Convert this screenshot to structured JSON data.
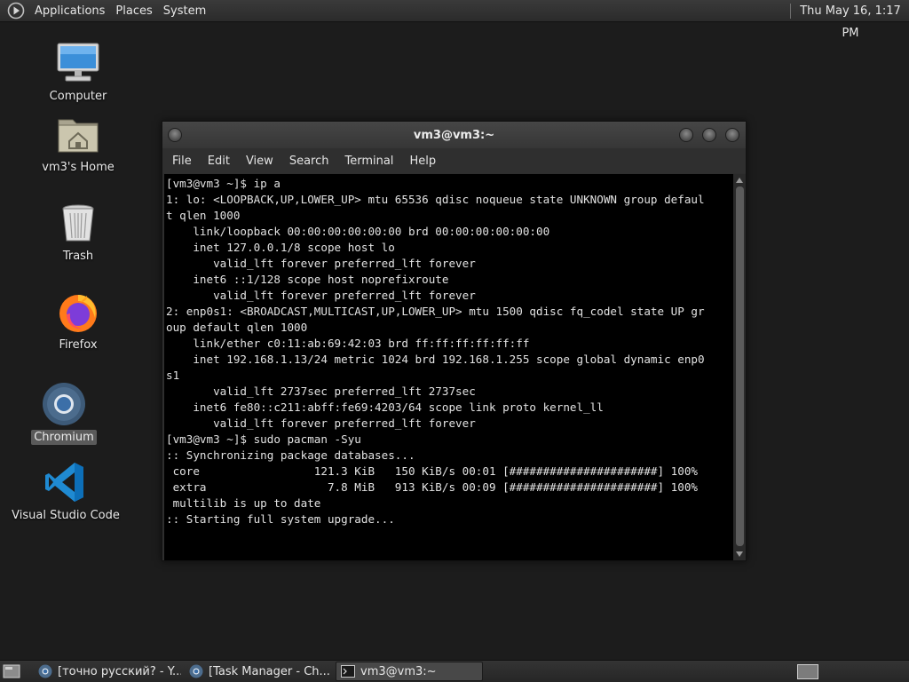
{
  "top_panel": {
    "menus": [
      "Applications",
      "Places",
      "System"
    ],
    "clock": "Thu May 16,  1:17 PM"
  },
  "desktop_icons": [
    {
      "label": "Computer",
      "icon": "computer-icon"
    },
    {
      "label": "vm3's Home",
      "icon": "home-folder-icon"
    },
    {
      "label": "Trash",
      "icon": "trash-icon"
    },
    {
      "label": "Firefox",
      "icon": "firefox-icon"
    },
    {
      "label": "Chromium",
      "icon": "chromium-icon",
      "selected": true
    },
    {
      "label": "Visual Studio Code",
      "icon": "vscode-icon"
    }
  ],
  "terminal": {
    "title": "vm3@vm3:~",
    "menu": [
      "File",
      "Edit",
      "View",
      "Search",
      "Terminal",
      "Help"
    ],
    "lines": [
      "[vm3@vm3 ~]$ ip a",
      "1: lo: <LOOPBACK,UP,LOWER_UP> mtu 65536 qdisc noqueue state UNKNOWN group defaul",
      "t qlen 1000",
      "    link/loopback 00:00:00:00:00:00 brd 00:00:00:00:00:00",
      "    inet 127.0.0.1/8 scope host lo",
      "       valid_lft forever preferred_lft forever",
      "    inet6 ::1/128 scope host noprefixroute",
      "       valid_lft forever preferred_lft forever",
      "2: enp0s1: <BROADCAST,MULTICAST,UP,LOWER_UP> mtu 1500 qdisc fq_codel state UP gr",
      "oup default qlen 1000",
      "    link/ether c0:11:ab:69:42:03 brd ff:ff:ff:ff:ff:ff",
      "    inet 192.168.1.13/24 metric 1024 brd 192.168.1.255 scope global dynamic enp0",
      "s1",
      "       valid_lft 2737sec preferred_lft 2737sec",
      "    inet6 fe80::c211:abff:fe69:4203/64 scope link proto kernel_ll",
      "       valid_lft forever preferred_lft forever",
      "[vm3@vm3 ~]$ sudo pacman -Syu",
      ":: Synchronizing package databases...",
      " core                 121.3 KiB   150 KiB/s 00:01 [######################] 100%",
      " extra                  7.8 MiB   913 KiB/s 00:09 [######################] 100%",
      " multilib is up to date",
      ":: Starting full system upgrade..."
    ]
  },
  "taskbar": {
    "tasks": [
      {
        "label": "[точно русский? - Y...",
        "icon": "chromium-icon",
        "active": false
      },
      {
        "label": "[Task Manager - Ch...",
        "icon": "chromium-icon",
        "active": false
      },
      {
        "label": "vm3@vm3:~",
        "icon": "terminal-icon",
        "active": true
      }
    ]
  },
  "colors": {
    "desktop_bg": "#1c1c1c",
    "panel_bg": "#2b2b2b",
    "terminal_bg": "#000000",
    "terminal_fg": "#e2e2e2",
    "selection": "#5a5a5a"
  }
}
